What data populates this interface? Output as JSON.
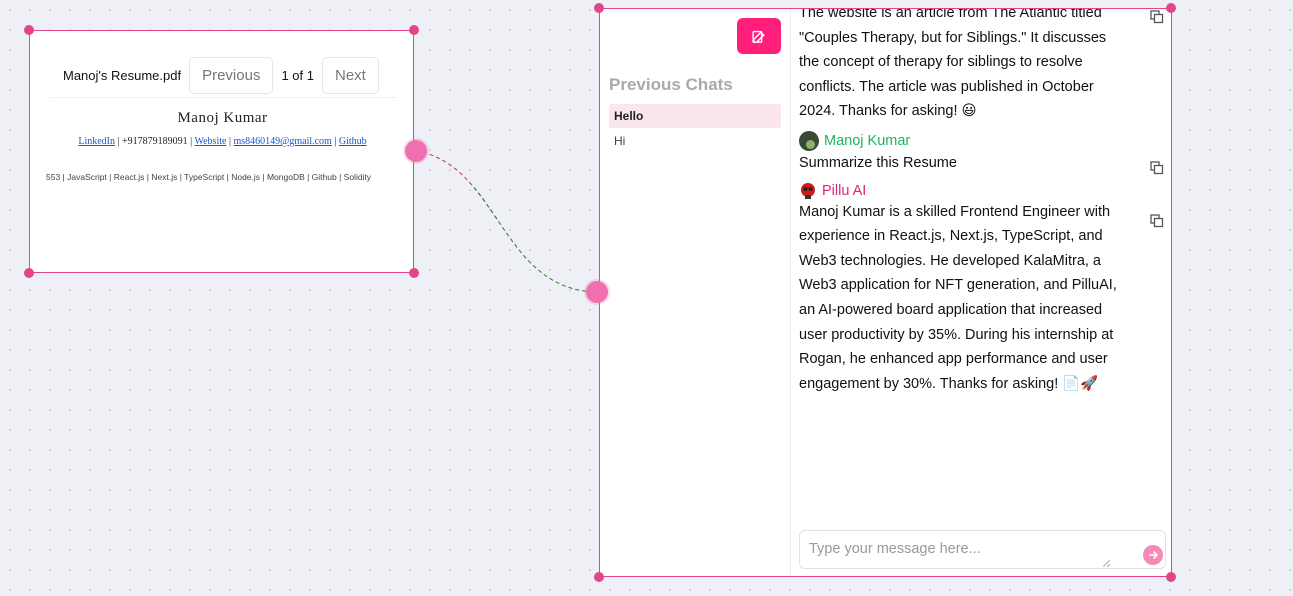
{
  "pdf_node": {
    "filename": "Manoj's Resume.pdf",
    "prev_label": "Previous",
    "page_indicator": "1 of 1",
    "next_label": "Next",
    "resume_name": "Manoj Kumar",
    "contact": {
      "linkedin": "LinkedIn",
      "phone": "+917879189091",
      "website": "Website",
      "email": "ms8460149@gmail.com",
      "github": "Github"
    },
    "skills_line": "553 | JavaScript | React.js | Next.js | TypeScript | Node.js | MongoDB | Github | Solidity"
  },
  "chat_node": {
    "sidebar": {
      "title": "Previous Chats",
      "chats": [
        "Hello",
        "Hi"
      ]
    },
    "messages": {
      "m1_text": "The website is an article from The Atlantic titled \"Couples Therapy, but for Siblings.\" It discusses the concept of therapy for siblings to resolve conflicts. The article was published in October 2024. Thanks for asking! 😃",
      "user_name": "Manoj Kumar",
      "user_text": "Summarize this Resume",
      "ai_name": "Pillu AI",
      "ai_text": "Manoj Kumar is a skilled Frontend Engineer with experience in React.js, Next.js, TypeScript, and Web3 technologies. He developed KalaMitra, a Web3 application for NFT generation, and PilluAI, an AI-powered board application that increased user productivity by 35%. During his internship at Rogan, he enhanced app performance and user engagement by 30%. Thanks for asking! 📄🚀"
    },
    "input_placeholder": "Type your message here..."
  },
  "colors": {
    "accent": "#ff1f7a",
    "node_border": "#e0468b",
    "user_name": "#22b35e",
    "ai_name": "#e0267a"
  }
}
